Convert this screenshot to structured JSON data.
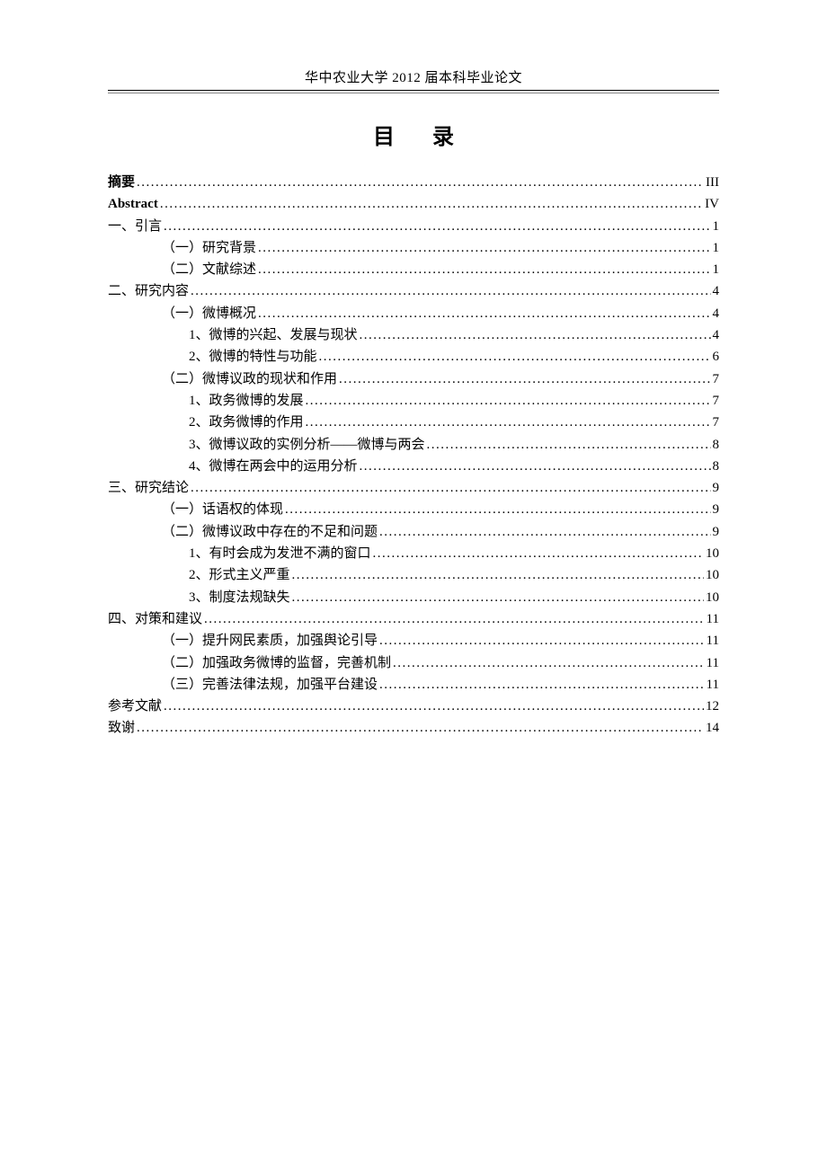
{
  "header": "华中农业大学 2012 届本科毕业论文",
  "title": "目 录",
  "toc": [
    {
      "label": "摘要",
      "page": "III",
      "indent": 0,
      "style": "bold"
    },
    {
      "label": "Abstract",
      "page": "IV",
      "indent": 0,
      "style": "abstract-en"
    },
    {
      "label": "一、引言",
      "page": "1",
      "indent": 0,
      "style": ""
    },
    {
      "label": "（一）研究背景",
      "page": "1",
      "indent": 1,
      "style": ""
    },
    {
      "label": "（二）文献综述",
      "page": "1",
      "indent": 1,
      "style": ""
    },
    {
      "label": "二、研究内容",
      "page": "4",
      "indent": 0,
      "style": ""
    },
    {
      "label": "（一）微博概况",
      "page": "4",
      "indent": 1,
      "style": ""
    },
    {
      "label": "1、微博的兴起、发展与现状",
      "page": "4",
      "indent": 2,
      "style": ""
    },
    {
      "label": "2、微博的特性与功能",
      "page": "6",
      "indent": 2,
      "style": ""
    },
    {
      "label": "（二）微博议政的现状和作用",
      "page": "7",
      "indent": 1,
      "style": ""
    },
    {
      "label": "1、政务微博的发展",
      "page": "7",
      "indent": 2,
      "style": ""
    },
    {
      "label": "2、政务微博的作用",
      "page": "7",
      "indent": 2,
      "style": ""
    },
    {
      "label": "3、微博议政的实例分析——微博与两会",
      "page": "8",
      "indent": 2,
      "style": ""
    },
    {
      "label": "4、微博在两会中的运用分析",
      "page": "8",
      "indent": 2,
      "style": ""
    },
    {
      "label": "三、研究结论",
      "page": "9",
      "indent": 0,
      "style": ""
    },
    {
      "label": "（一）话语权的体现",
      "page": "9",
      "indent": 1,
      "style": ""
    },
    {
      "label": "（二）微博议政中存在的不足和问题",
      "page": "9",
      "indent": 1,
      "style": ""
    },
    {
      "label": "1、有时会成为发泄不满的窗口",
      "page": "10",
      "indent": 2,
      "style": ""
    },
    {
      "label": "2、形式主义严重",
      "page": "10",
      "indent": 2,
      "style": ""
    },
    {
      "label": "3、制度法规缺失",
      "page": "10",
      "indent": 2,
      "style": ""
    },
    {
      "label": "四、对策和建议",
      "page": "11",
      "indent": 0,
      "style": ""
    },
    {
      "label": "（一）提升网民素质，加强舆论引导",
      "page": "11",
      "indent": 1,
      "style": ""
    },
    {
      "label": "（二）加强政务微博的监督，完善机制",
      "page": "11",
      "indent": 1,
      "style": ""
    },
    {
      "label": "（三）完善法律法规，加强平台建设",
      "page": "11",
      "indent": 1,
      "style": ""
    },
    {
      "label": "参考文献",
      "page": "12",
      "indent": 0,
      "style": ""
    },
    {
      "label": "致谢",
      "page": "14",
      "indent": 0,
      "style": ""
    }
  ]
}
